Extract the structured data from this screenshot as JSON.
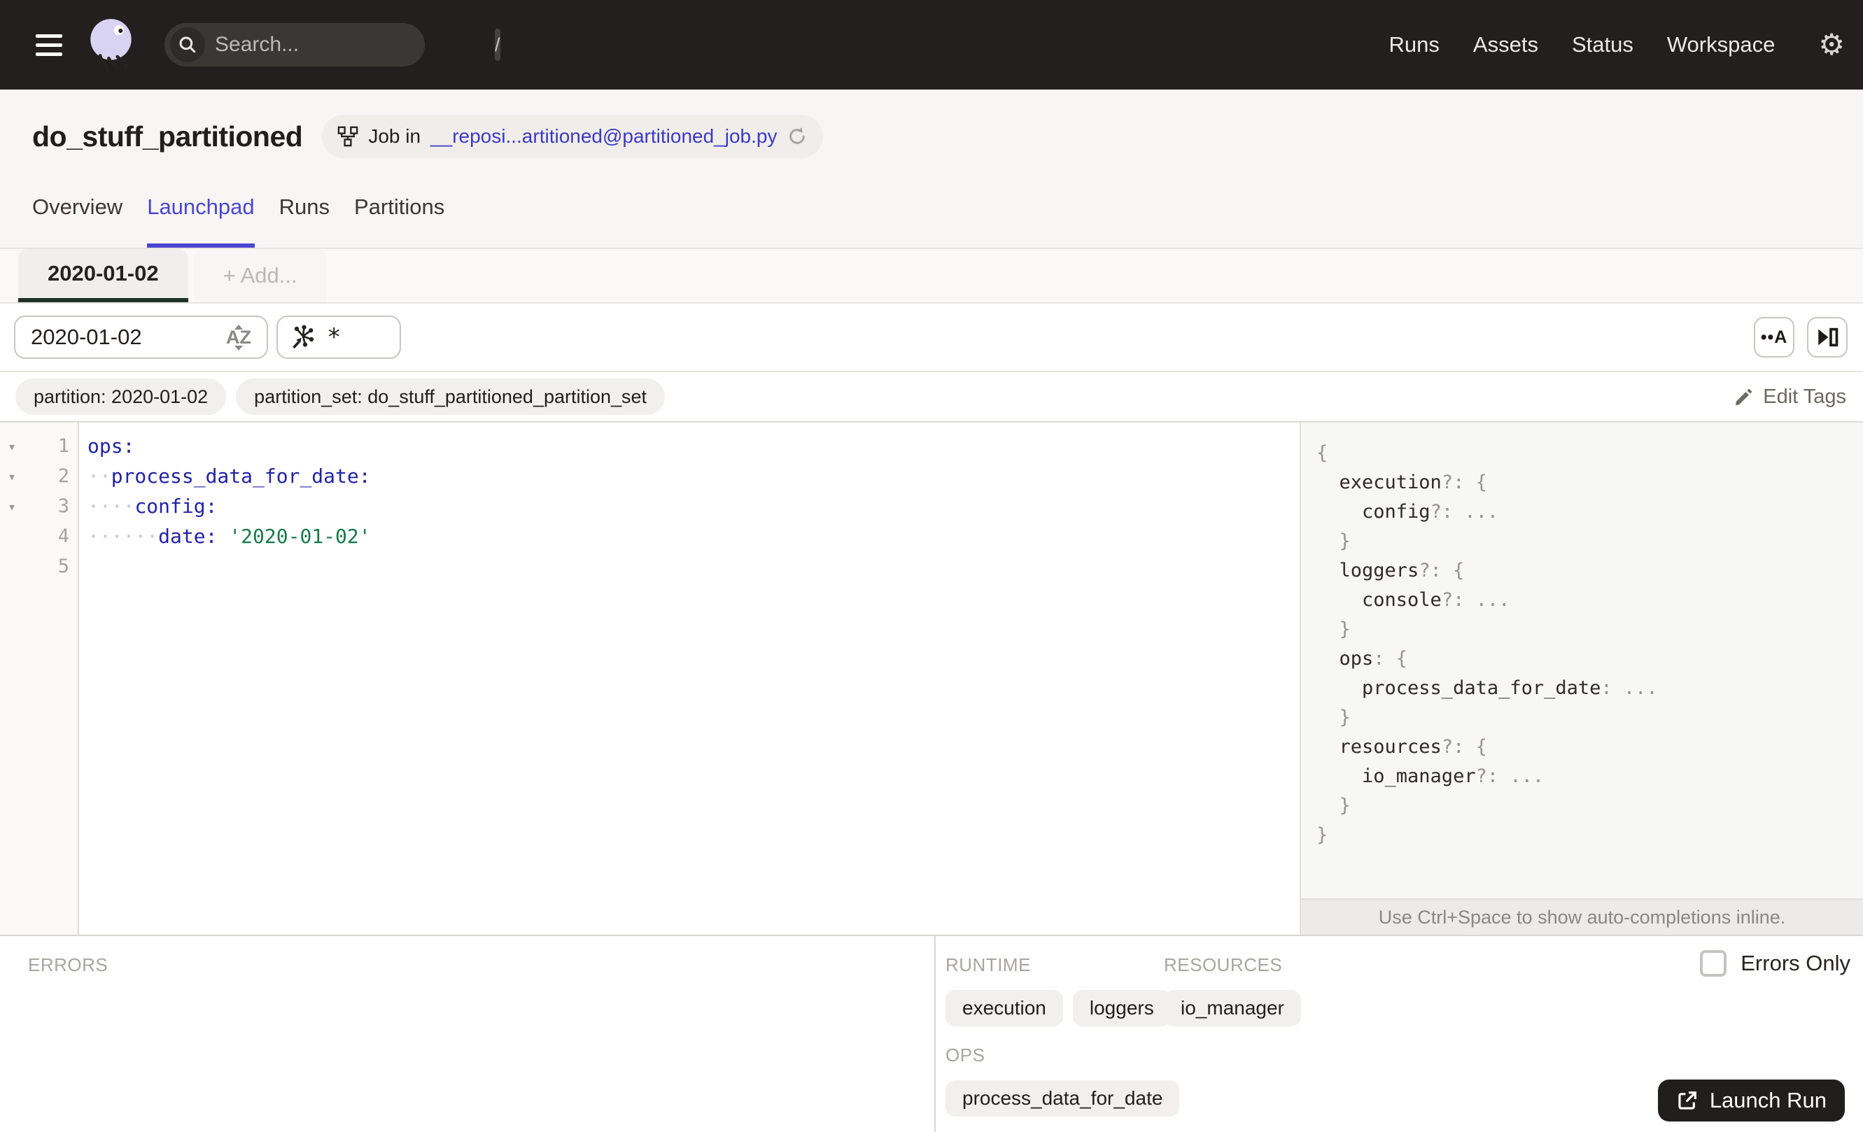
{
  "colors": {
    "navbar_bg": "#231F1E",
    "accent_blue": "#4B45D2",
    "link_blue": "#3D38C7",
    "code_key": "#2222A8",
    "code_string": "#15794A",
    "config_tab_underline": "#20312A",
    "launch_button_bg": "#211E1E"
  },
  "navbar": {
    "search_placeholder": "Search...",
    "search_shortcut": "/",
    "items": [
      {
        "label": "Runs"
      },
      {
        "label": "Assets"
      },
      {
        "label": "Status"
      },
      {
        "label": "Workspace"
      }
    ]
  },
  "header": {
    "title": "do_stuff_partitioned",
    "job_badge": {
      "prefix": "Job in",
      "link": "__reposi...artitioned@partitioned_job.py"
    },
    "tabs": [
      {
        "label": "Overview"
      },
      {
        "label": "Launchpad"
      },
      {
        "label": "Runs"
      },
      {
        "label": "Partitions"
      }
    ]
  },
  "config_tabs": {
    "active": "2020-01-02",
    "add": "+ Add..."
  },
  "filter": {
    "partition_value": "2020-01-02",
    "az_label": "AZ",
    "op_selector_value": "*"
  },
  "tags": {
    "items": [
      "partition: 2020-01-02",
      "partition_set: do_stuff_partitioned_partition_set"
    ],
    "edit_label": "Edit Tags"
  },
  "editor": {
    "lines": [
      {
        "num": "1",
        "fold": "▾",
        "ws": "",
        "key": "ops:",
        "val": ""
      },
      {
        "num": "2",
        "fold": "▾",
        "ws": "··",
        "key": "process_data_for_date:",
        "val": ""
      },
      {
        "num": "3",
        "fold": "▾",
        "ws": "····",
        "key": "config:",
        "val": ""
      },
      {
        "num": "4",
        "fold": "",
        "ws": "······",
        "key": "date:",
        "val": " '2020-01-02'"
      },
      {
        "num": "5",
        "fold": "",
        "ws": "",
        "key": "",
        "val": ""
      }
    ]
  },
  "schema": {
    "lines": [
      {
        "dark": "",
        "gray": "{"
      },
      {
        "dark": "  execution",
        "gray": "?: {"
      },
      {
        "dark": "    config",
        "gray": "?: ..."
      },
      {
        "dark": "",
        "gray": "  }"
      },
      {
        "dark": "  loggers",
        "gray": "?: {"
      },
      {
        "dark": "    console",
        "gray": "?: ..."
      },
      {
        "dark": "",
        "gray": "  }"
      },
      {
        "dark": "  ops",
        "gray": ": {"
      },
      {
        "dark": "    process_data_for_date",
        "gray": ": ..."
      },
      {
        "dark": "",
        "gray": "  }"
      },
      {
        "dark": "  resources",
        "gray": "?: {"
      },
      {
        "dark": "    io_manager",
        "gray": "?: ..."
      },
      {
        "dark": "",
        "gray": "  }"
      },
      {
        "dark": "",
        "gray": "}"
      }
    ],
    "hint": "Use Ctrl+Space to show auto-completions inline."
  },
  "bottom": {
    "errors_label": "ERRORS",
    "runtime_label": "RUNTIME",
    "runtime_chips": [
      "execution",
      "loggers"
    ],
    "resources_label": "RESOURCES",
    "resources_chips": [
      "io_manager"
    ],
    "ops_label": "OPS",
    "ops_chips": [
      "process_data_for_date"
    ],
    "errors_only_label": "Errors Only",
    "launch_label": "Launch Run"
  }
}
